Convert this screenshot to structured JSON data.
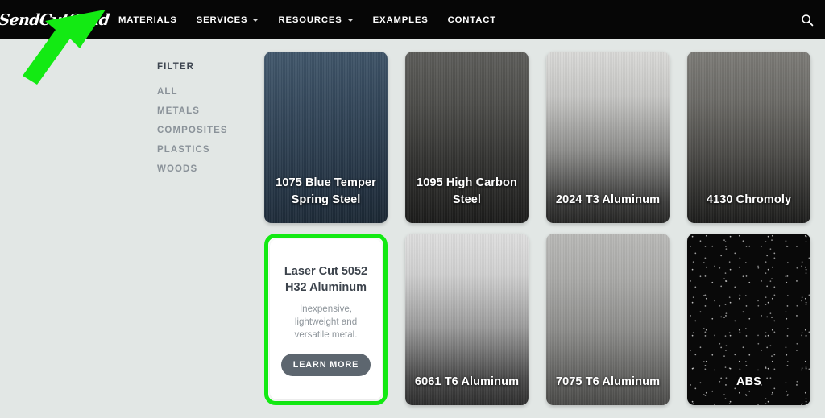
{
  "site": {
    "logo_text": "SendCutSend",
    "background_color": "#e2e7e5",
    "nav_background_color": "#060606",
    "highlight_color": "#13ea13",
    "button_color": "#5d666f"
  },
  "nav": {
    "items": [
      {
        "label": "MATERIALS",
        "has_caret": false,
        "active": true,
        "icon": ""
      },
      {
        "label": "SERVICES",
        "has_caret": true,
        "active": false,
        "icon": "chevron-down-icon"
      },
      {
        "label": "RESOURCES",
        "has_caret": true,
        "active": false,
        "icon": "chevron-down-icon"
      },
      {
        "label": "EXAMPLES",
        "has_caret": false,
        "active": false,
        "icon": ""
      },
      {
        "label": "CONTACT",
        "has_caret": false,
        "active": false,
        "icon": ""
      }
    ],
    "search_icon": "search-icon"
  },
  "annotation": {
    "type": "arrow",
    "icon": "green-arrow-annotation",
    "color": "#13ea13",
    "points_to": "MATERIALS"
  },
  "filter": {
    "title": "FILTER",
    "items": [
      {
        "label": "ALL"
      },
      {
        "label": "METALS"
      },
      {
        "label": "COMPOSITES"
      },
      {
        "label": "PLASTICS"
      },
      {
        "label": "WOODS"
      }
    ]
  },
  "materials": [
    {
      "name": "1075 Blue Temper Spring Steel",
      "texture": "tex-spring",
      "highlighted": false
    },
    {
      "name": "1095 High Carbon Steel",
      "texture": "tex-carbon",
      "highlighted": false
    },
    {
      "name": "2024 T3 Aluminum",
      "texture": "tex-alum2024",
      "highlighted": false
    },
    {
      "name": "4130 Chromoly",
      "texture": "tex-chromoly",
      "highlighted": false
    },
    {
      "name": "Laser Cut 5052 H32 Aluminum",
      "texture": "",
      "highlighted": true,
      "description": "Inexpensive, lightweight and versatile metal.",
      "button_label": "LEARN MORE"
    },
    {
      "name": "6061 T6 Aluminum",
      "texture": "tex-alum6061",
      "highlighted": false
    },
    {
      "name": "7075 T6 Aluminum",
      "texture": "tex-alum7075",
      "highlighted": false
    },
    {
      "name": "ABS",
      "texture": "tex-abs",
      "highlighted": false
    }
  ]
}
